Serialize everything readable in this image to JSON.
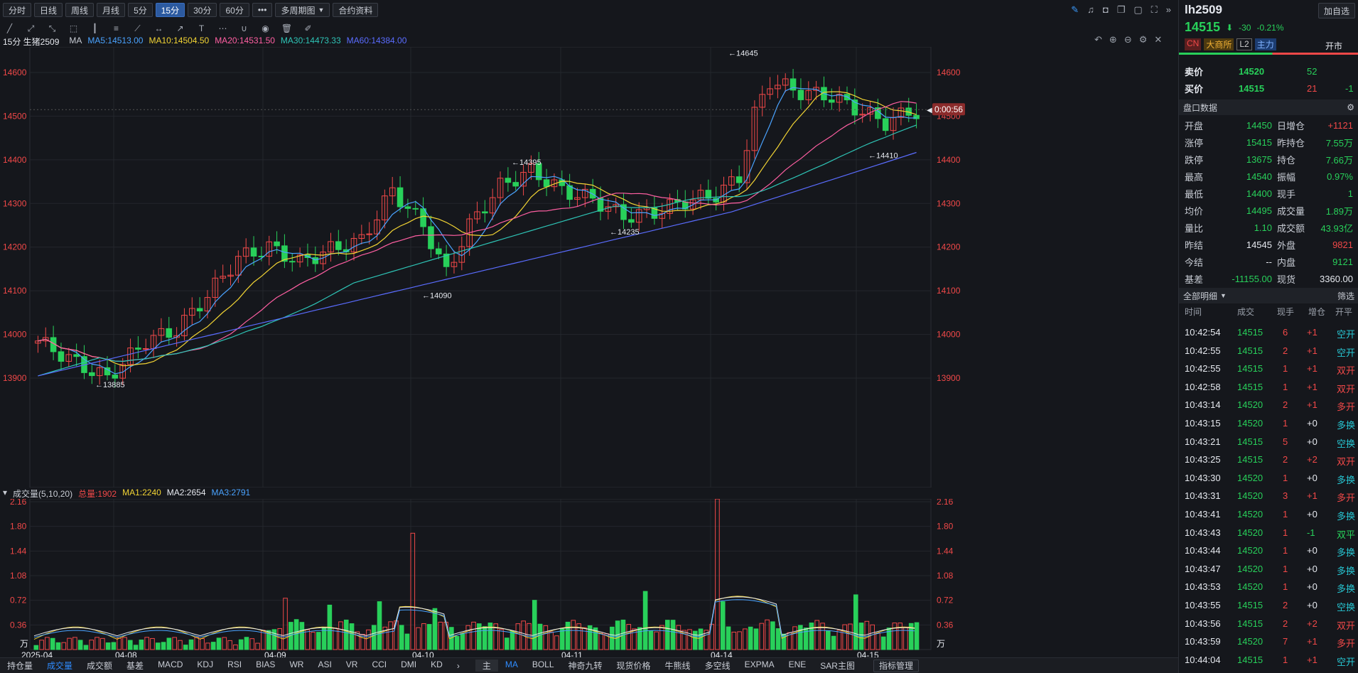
{
  "toolbar": {
    "periods": [
      "分时",
      "日线",
      "周线",
      "月线",
      "5分",
      "15分",
      "30分",
      "60分"
    ],
    "active": "15分",
    "more": "•••",
    "multi": "多周期图",
    "info": "合约资料"
  },
  "legend": {
    "period": "15分 生猪2509",
    "ma": "MA",
    "ma5": "MA5:14513.00",
    "ma10": "MA10:14504.50",
    "ma20": "MA20:14531.50",
    "ma30": "MA30:14473.33",
    "ma60": "MA60:14384.00",
    "ma5_color": "#4aa3ff",
    "ma10_color": "#f2d434",
    "ma20_color": "#ff5fa2",
    "ma30_color": "#2ec4b6",
    "ma60_color": "#5a6cff"
  },
  "price_axis": [
    "14600",
    "14500",
    "14400",
    "14300",
    "14200",
    "14100",
    "14000",
    "13900"
  ],
  "annotations": {
    "high": "14645",
    "a": "14395",
    "b": "14235",
    "c": "14090",
    "d": "13885",
    "e": "14410"
  },
  "countdown": "0:00:56",
  "vol_legend": {
    "title": "成交量(5,10,20)",
    "total": "总量:1902",
    "ma1": "MA1:2240",
    "ma2": "MA2:2654",
    "ma3": "MA3:2791"
  },
  "vol_axis": [
    "2.16",
    "1.80",
    "1.44",
    "1.08",
    "0.72",
    "0.36"
  ],
  "vol_unit": "万",
  "dates": [
    "2025-04",
    "04-08",
    "04-09",
    "04-10",
    "04-11",
    "04-14",
    "04-15"
  ],
  "bottom_tabs": [
    "持仓量",
    "成交量",
    "成交额",
    "基差",
    "MACD",
    "KDJ",
    "RSI",
    "BIAS",
    "WR",
    "ASI",
    "VR",
    "CCI",
    "DMI",
    "KD"
  ],
  "bottom_tabs2": [
    "主",
    "MA",
    "BOLL",
    "神奇九转",
    "现货价格",
    "牛熊线",
    "多空线",
    "EXPMA",
    "ENE",
    "SAR主图"
  ],
  "indicator_mgr": "指标管理",
  "right": {
    "symbol": "lh2509",
    "add": "加自选",
    "price": "14515",
    "change": "-30",
    "pct": "-0.21%",
    "tags": [
      "CN",
      "大商所",
      "L2",
      "主力"
    ],
    "open_market": "开市",
    "ask_label": "卖价",
    "ask": "14520",
    "ask_vol": "52",
    "bid_label": "买价",
    "bid": "14515",
    "bid_vol": "21",
    "bid_chg": "-1",
    "panel_title": "盘口数据",
    "stats": [
      [
        "开盘",
        "14450",
        "日增仓",
        "+1121"
      ],
      [
        "涨停",
        "15415",
        "昨持仓",
        "7.55万"
      ],
      [
        "跌停",
        "13675",
        "持仓",
        "7.66万"
      ],
      [
        "最高",
        "14540",
        "振幅",
        "0.97%"
      ],
      [
        "最低",
        "14400",
        "现手",
        "1"
      ],
      [
        "均价",
        "14495",
        "成交量",
        "1.89万"
      ],
      [
        "量比",
        "1.10",
        "成交额",
        "43.93亿"
      ],
      [
        "昨结",
        "14545",
        "外盘",
        "9821"
      ],
      [
        "今结",
        "--",
        "内盘",
        "9121"
      ],
      [
        "基差",
        "-11155.00",
        "现货",
        "3360.00"
      ]
    ],
    "detail_title": "全部明细",
    "filter": "筛选",
    "cols": [
      "时间",
      "成交",
      "现手",
      "增仓",
      "开平"
    ],
    "ticks": [
      [
        "10:42:54",
        "14515",
        "6",
        "+1",
        "空开"
      ],
      [
        "10:42:55",
        "14515",
        "2",
        "+1",
        "空开"
      ],
      [
        "10:42:55",
        "14515",
        "1",
        "+1",
        "双开"
      ],
      [
        "10:42:58",
        "14515",
        "1",
        "+1",
        "双开"
      ],
      [
        "10:43:14",
        "14520",
        "2",
        "+1",
        "多开"
      ],
      [
        "10:43:15",
        "14520",
        "1",
        "+0",
        "多换"
      ],
      [
        "10:43:21",
        "14515",
        "5",
        "+0",
        "空换"
      ],
      [
        "10:43:25",
        "14515",
        "2",
        "+2",
        "双开"
      ],
      [
        "10:43:30",
        "14520",
        "1",
        "+0",
        "多换"
      ],
      [
        "10:43:31",
        "14520",
        "3",
        "+1",
        "多开"
      ],
      [
        "10:43:41",
        "14520",
        "1",
        "+0",
        "多换"
      ],
      [
        "10:43:43",
        "14520",
        "1",
        "-1",
        "双平"
      ],
      [
        "10:43:44",
        "14520",
        "1",
        "+0",
        "多换"
      ],
      [
        "10:43:47",
        "14520",
        "1",
        "+0",
        "多换"
      ],
      [
        "10:43:53",
        "14520",
        "1",
        "+0",
        "多换"
      ],
      [
        "10:43:55",
        "14515",
        "2",
        "+0",
        "空换"
      ],
      [
        "10:43:56",
        "14515",
        "2",
        "+2",
        "双开"
      ],
      [
        "10:43:59",
        "14520",
        "7",
        "+1",
        "多开"
      ],
      [
        "10:44:04",
        "14515",
        "1",
        "+1",
        "空开"
      ]
    ]
  }
}
